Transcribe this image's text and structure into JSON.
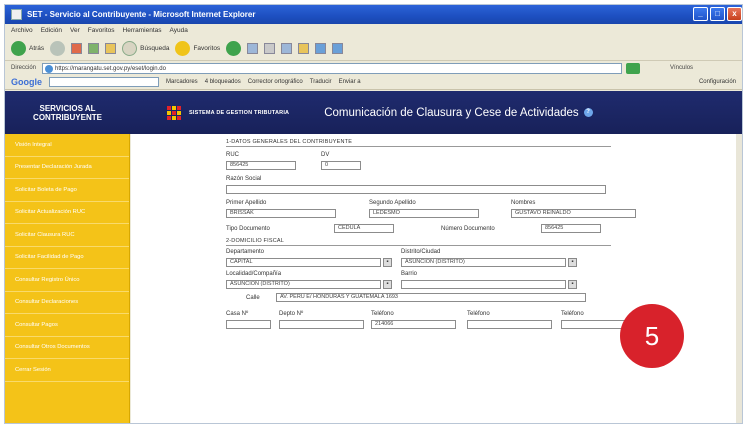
{
  "window": {
    "title": "SET - Servicio al Contribuyente - Microsoft Internet Explorer",
    "controls": [
      "_",
      "□",
      "x"
    ]
  },
  "menubar": [
    "Archivo",
    "Edición",
    "Ver",
    "Favoritos",
    "Herramientas",
    "Ayuda"
  ],
  "toolbar": {
    "back_label": "Atrás",
    "search_label": "Búsqueda",
    "favorites_label": "Favoritos"
  },
  "address": {
    "label": "Dirección",
    "url": "https://marangatu.set.gov.py/eset/login.do",
    "links_label": "Vínculos"
  },
  "googlebar": {
    "logo": "Google",
    "items": [
      "Marcadores",
      "4 bloqueados",
      "Corrector ortográfico",
      "Traducir",
      "Enviar a"
    ],
    "config_label": "Configuración"
  },
  "site": {
    "brand": "SERVICIOS AL CONTRIBUYENTE",
    "system_name": "SISTEMA DE GESTION TRIBUTARIA",
    "page_heading": "Comunicación de Clausura y Cese de Actividades",
    "help_icon_label": "?"
  },
  "sidebar": {
    "items": [
      "Visión Integral",
      "Presentar Declaración Jurada",
      "Solicitar Boleta de Pago",
      "Solicitar Actualización RUC",
      "Solicitar Clausura RUC",
      "Solicitar Facilidad de Pago",
      "Consultar Registro Único",
      "Consultar Declaraciones",
      "Consultar Pagos",
      "Consultar Otros Documentos",
      "Cerrar Sesión"
    ]
  },
  "form": {
    "section_general": "1-DATOS GENERALES DEL CONTRIBUYENTE",
    "ruc_label": "RUC",
    "ruc_value": "856425",
    "dv_label": "DV",
    "dv_value": "0",
    "razon_label": "Razón Social",
    "razon_value": "",
    "primer_apellido_label": "Primer Apellido",
    "primer_apellido_value": "BRISSAK",
    "segundo_apellido_label": "Segundo Apellido",
    "segundo_apellido_value": "LEDESMO",
    "nombres_label": "Nombres",
    "nombres_value": "GUSTAVO REINALDO",
    "tipo_doc_label": "Tipo Documento",
    "tipo_doc_value": "CEDULA",
    "num_doc_label": "Número Documento",
    "num_doc_value": "856425",
    "section_domicilio": "2-DOMICILIO FISCAL",
    "departamento_label": "Departamento",
    "departamento_value": "CAPITAL",
    "distrito_label": "Distrito/Ciudad",
    "distrito_value": "ASUNCION (DISTRITO)",
    "localidad_label": "Localidad/Compañía",
    "localidad_value": "ASUNCION (DISTRITO)",
    "barrio_label": "Barrio",
    "barrio_value": "",
    "calle_label": "Calle",
    "calle_value": "AV. PERU E/ HONDURAS Y GUATEMALA 1693",
    "casa_label": "Casa Nº",
    "casa_value": "",
    "depto_label": "Depto Nº",
    "depto_value": "",
    "telefono1_label": "Teléfono",
    "telefono1_value": "214066",
    "telefono2_label": "Teléfono",
    "telefono2_value": "",
    "telefono3_label": "Teléfono",
    "telefono3_value": ""
  },
  "step_badge": "5",
  "colors": {
    "header_navy": "#1f2b6e",
    "sidebar_yellow": "#f4c318",
    "badge_red": "#d8222b",
    "titlebar_blue": "#2c63d8"
  }
}
